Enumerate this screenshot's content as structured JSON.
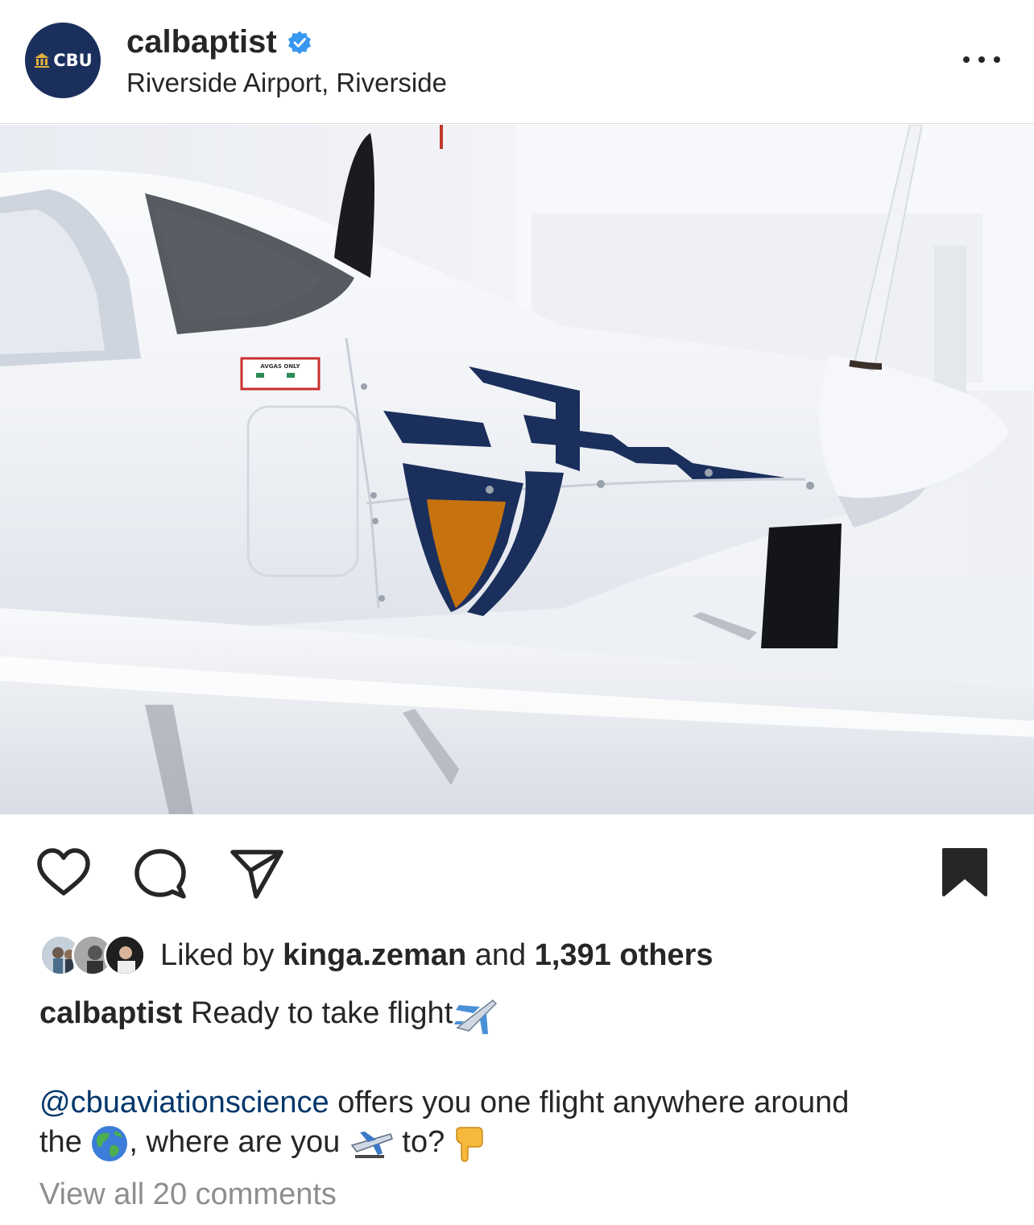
{
  "header": {
    "avatar_text": "CBU",
    "username": "calbaptist",
    "location": "Riverside Airport, Riverside"
  },
  "photo": {
    "label_top": "AVGAS ONLY"
  },
  "likes": {
    "prefix": "Liked by ",
    "user": "kinga.zeman",
    "middle": " and ",
    "count": "1,391 others"
  },
  "caption": {
    "username": "calbaptist",
    "text": " Ready to take flight"
  },
  "body": {
    "mention": "@cbuaviationscience",
    "line1": " offers you one flight anywhere around",
    "line2a": "the ",
    "line2b": ", where are you ",
    "line2c": " to? "
  },
  "comments": {
    "label": "View all 20 comments"
  },
  "colors": {
    "navy": "#1b2f5c",
    "orange": "#c5720f",
    "verified": "#3897f0",
    "mention": "#00376b"
  }
}
